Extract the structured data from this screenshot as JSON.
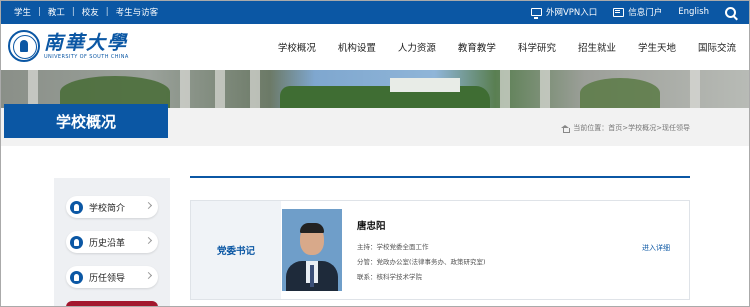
{
  "topbar": {
    "links": [
      "学生",
      "教工",
      "校友",
      "考生与访客"
    ],
    "vpn_label": "外网VPN入口",
    "portal_label": "信息门户",
    "english_label": "English"
  },
  "logo": {
    "cn": "南華大學",
    "en": "UNIVERSITY OF SOUTH CHINA"
  },
  "nav": [
    "学校概况",
    "机构设置",
    "人力资源",
    "教育教学",
    "科学研究",
    "招生就业",
    "学生天地",
    "国际交流"
  ],
  "section_title": "学校概况",
  "breadcrumb": "当前位置：首页>学校概况>现任领导",
  "sidebar": {
    "items": [
      {
        "label": "学校简介"
      },
      {
        "label": "历史沿革"
      },
      {
        "label": "历任领导"
      }
    ]
  },
  "card": {
    "role": "党委书记",
    "name": "唐忠阳",
    "lines": [
      "主持：学校党委全面工作",
      "分管：党政办公室(法律事务办、政策研究室)",
      "联系：核科学技术学院"
    ],
    "detail_link": "进入详细"
  },
  "colors": {
    "primary": "#0b57a4",
    "accent_red": "#a3172d"
  }
}
